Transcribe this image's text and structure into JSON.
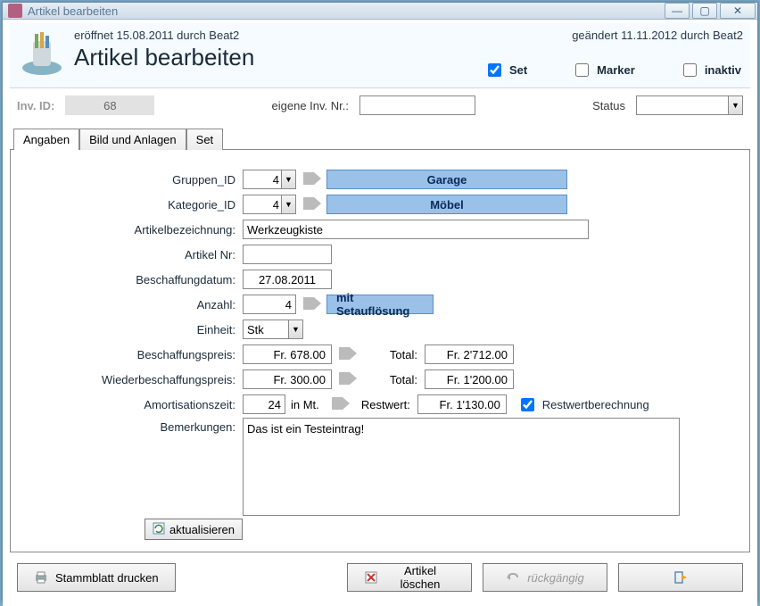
{
  "window": {
    "title": "Artikel bearbeiten"
  },
  "meta": {
    "created": "eröffnet 15.08.2011 durch Beat2",
    "modified": "geändert 11.11.2012 durch Beat2"
  },
  "page": {
    "title": "Artikel bearbeiten"
  },
  "flags": {
    "set_label": "Set",
    "set_checked": true,
    "marker_label": "Marker",
    "marker_checked": false,
    "inaktiv_label": "inaktiv",
    "inaktiv_checked": false
  },
  "inv": {
    "id_label": "Inv. ID:",
    "id_value": "68",
    "own_label": "eigene Inv. Nr.:",
    "own_value": "",
    "status_label": "Status",
    "status_value": ""
  },
  "tabs": {
    "angaben": "Angaben",
    "bild": "Bild und Anlagen",
    "set": "Set"
  },
  "form": {
    "gruppen_label": "Gruppen_ID",
    "gruppen_val": "4",
    "gruppen_name": "Garage",
    "kategorie_label": "Kategorie_ID",
    "kategorie_val": "4",
    "kategorie_name": "Möbel",
    "bezeichnung_label": "Artikelbezeichnung:",
    "bezeichnung_val": "Werkzeugkiste",
    "artikelnr_label": "Artikel Nr:",
    "artikelnr_val": "",
    "beschdatum_label": "Beschaffungdatum:",
    "beschdatum_val": "27.08.2011",
    "anzahl_label": "Anzahl:",
    "anzahl_val": "4",
    "setaufloesung": "mit Setauflösung",
    "einheit_label": "Einheit:",
    "einheit_val": "Stk",
    "beschpreis_label": "Beschaffungspreis:",
    "beschpreis_val": "Fr. 678.00",
    "total1_label": "Total:",
    "total1_val": "Fr. 2'712.00",
    "wiederbesch_label": "Wiederbeschaffungspreis:",
    "wiederbesch_val": "Fr. 300.00",
    "total2_label": "Total:",
    "total2_val": "Fr. 1'200.00",
    "amort_label": "Amortisationszeit:",
    "amort_val": "24",
    "amort_unit": "in Mt.",
    "restwert_label": "Restwert:",
    "restwert_val": "Fr. 1'130.00",
    "restwertcalc_label": "Restwertberechnung",
    "restwertcalc_checked": true,
    "bemerkungen_label": "Bemerkungen:",
    "bemerkungen_val": "Das ist ein Testeintrag!"
  },
  "actions": {
    "aktualisieren": "aktualisieren",
    "stammblatt": "Stammblatt drucken",
    "loeschen": "Artikel löschen",
    "rueckgaengig": "rückgängig",
    "close": ""
  }
}
